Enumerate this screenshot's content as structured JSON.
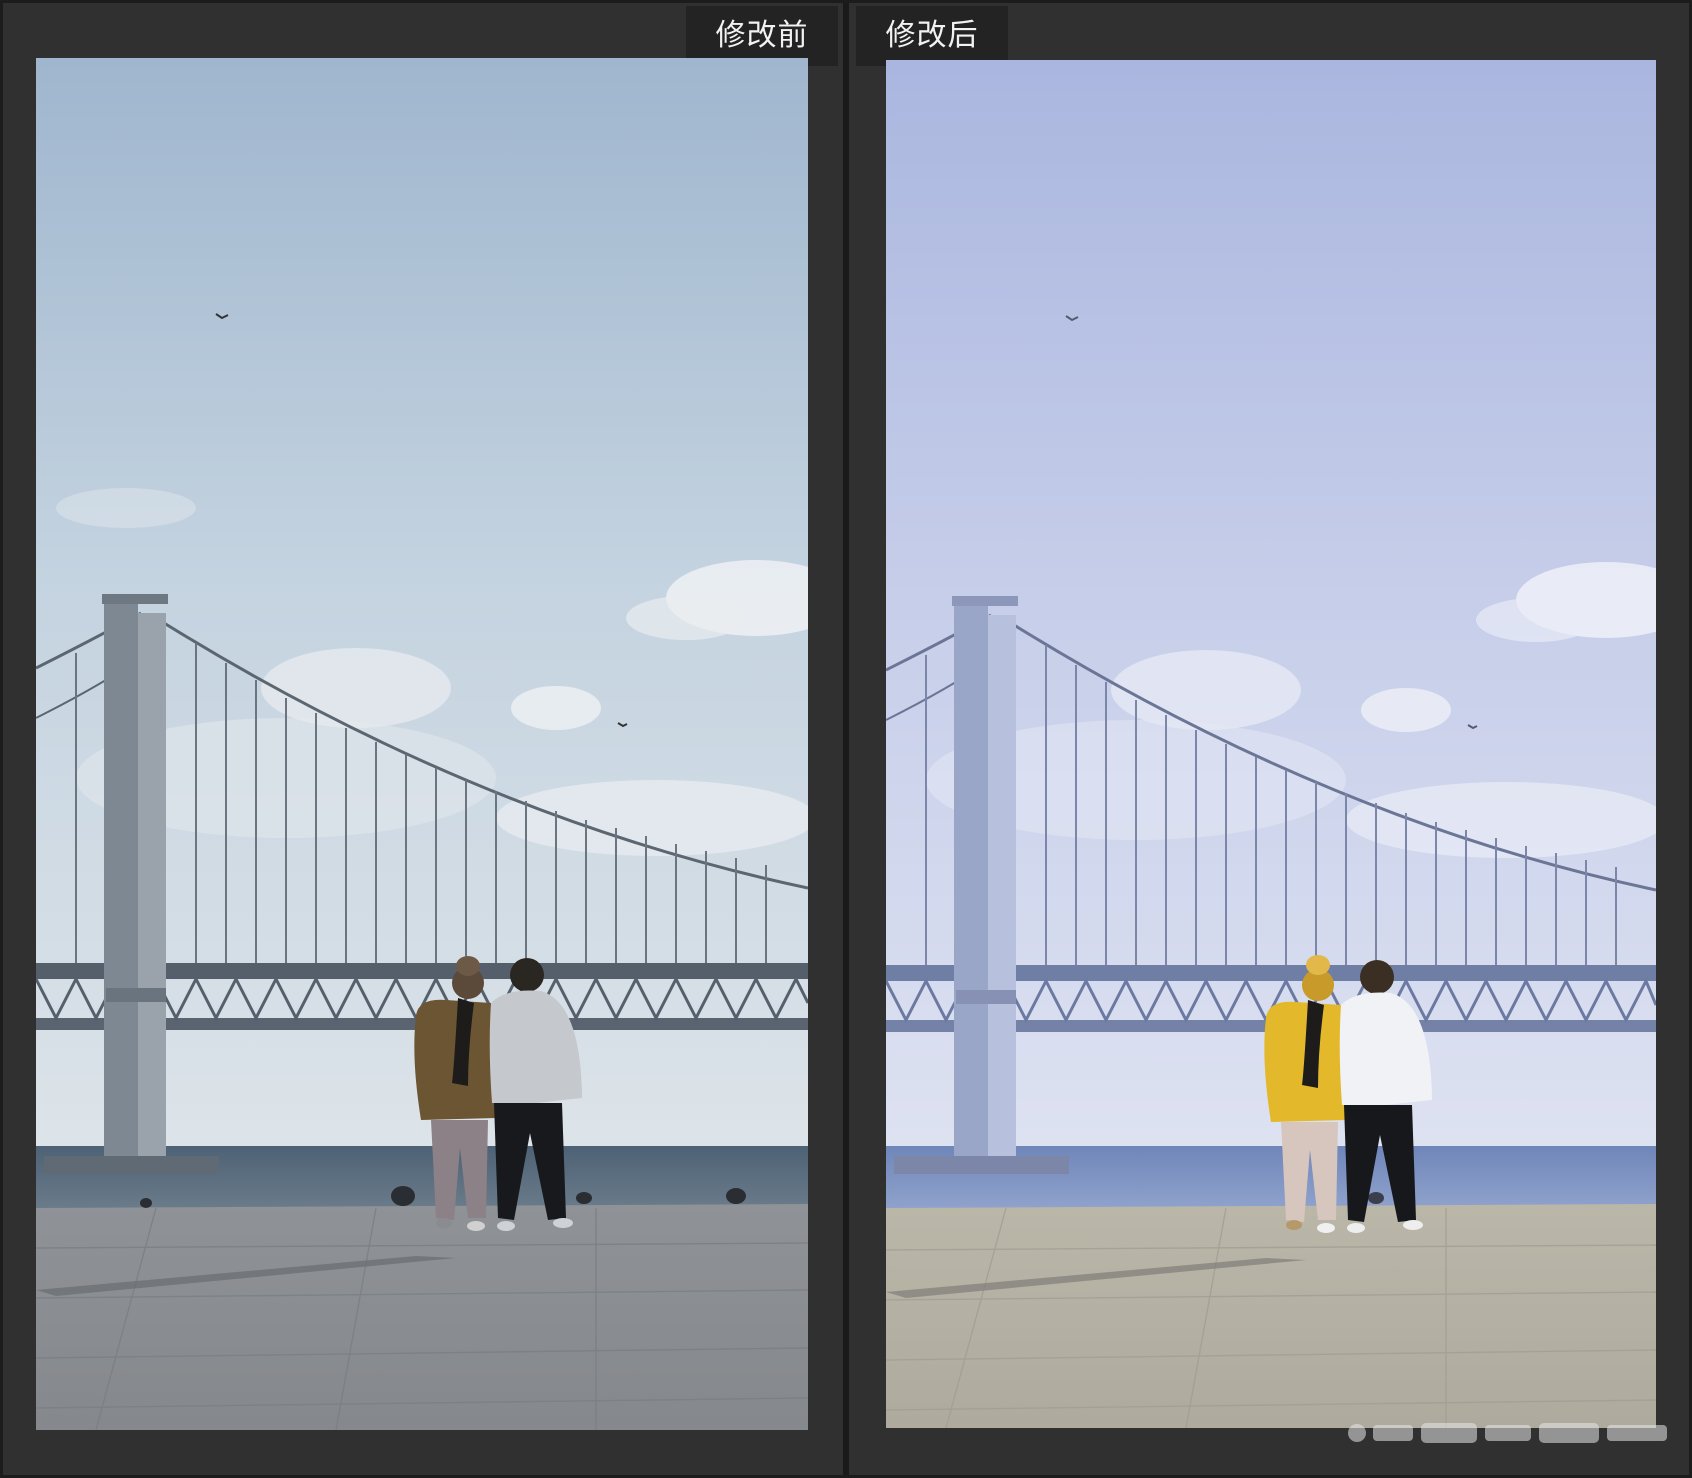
{
  "comparison": {
    "before_label": "修改前",
    "after_label": "修改后"
  },
  "colors": {
    "background": "#303030",
    "tab_background": "#232323",
    "tab_text": "#f2f2f2",
    "before_sky_top": "#9fb7cf",
    "before_sky_bottom": "#dbe3ea",
    "after_sky_top": "#aab6e0",
    "after_sky_bottom": "#dde2f1"
  },
  "icons": {
    "watermark": "watermark-logo"
  }
}
